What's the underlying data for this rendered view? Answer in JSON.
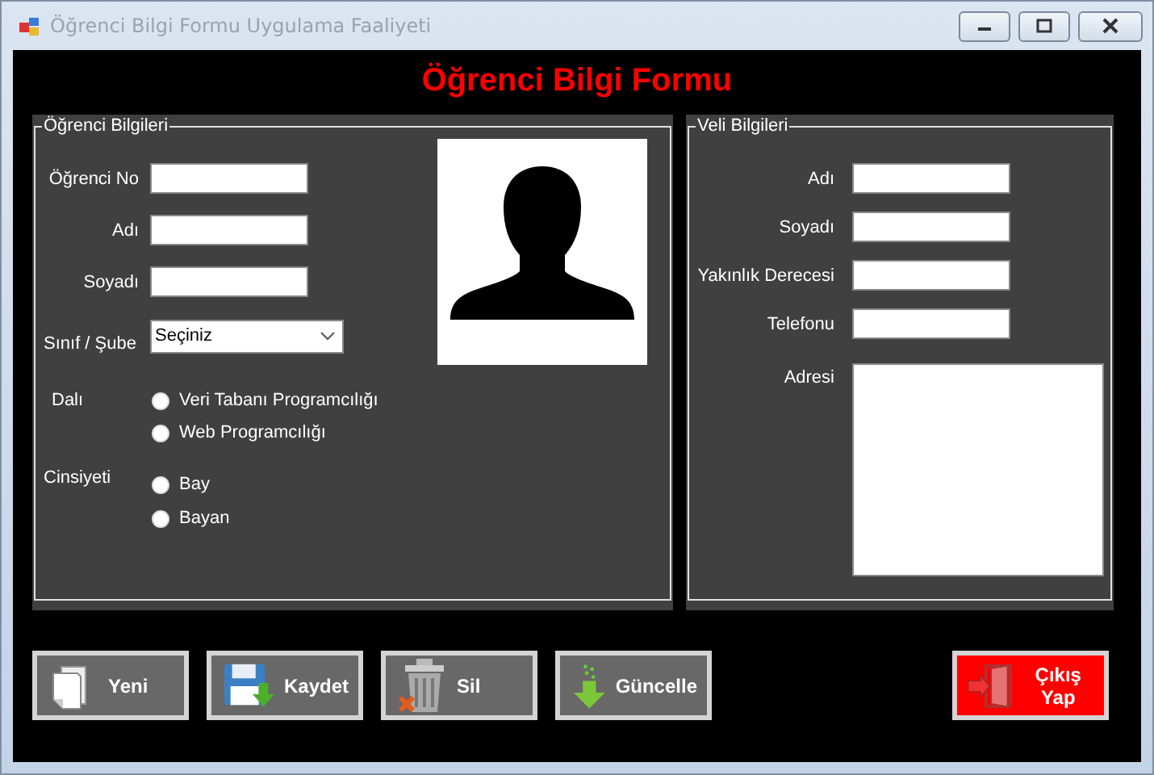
{
  "window": {
    "title": "Öğrenci Bilgi Formu Uygulama Faaliyeti"
  },
  "heading": "Öğrenci Bilgi Formu",
  "student": {
    "title": "Öğrenci Bilgileri",
    "fields": [
      {
        "label": "Öğrenci No",
        "kind": "text"
      },
      {
        "label": "Adı",
        "kind": "text"
      },
      {
        "label": "Soyadı",
        "kind": "text"
      },
      {
        "label": "Sınıf / Şube",
        "kind": "combo",
        "value": "Seçiniz"
      }
    ],
    "branch": {
      "label": "Dalı",
      "options": [
        {
          "label": "Veri Tabanı Programcılığı",
          "selected": false
        },
        {
          "label": "Web Programcılığı",
          "selected": false
        }
      ]
    },
    "gender": {
      "label": "Cinsiyeti",
      "options": [
        {
          "label": "Bay",
          "selected": false
        },
        {
          "label": "Bayan",
          "selected": false
        }
      ]
    }
  },
  "parent": {
    "title": "Veli Bilgileri",
    "fields": [
      {
        "label": "Adı",
        "kind": "text"
      },
      {
        "label": "Soyadı",
        "kind": "text"
      },
      {
        "label": "Yakınlık Derecesi",
        "kind": "text"
      },
      {
        "label": "Telefonu",
        "kind": "text"
      },
      {
        "label": "Adresi",
        "kind": "multiline"
      }
    ]
  },
  "buttons": [
    {
      "label": "Yeni",
      "kind": "new"
    },
    {
      "label": "Kaydet",
      "kind": "save"
    },
    {
      "label": "Sil",
      "kind": "delete"
    },
    {
      "label": "Güncelle",
      "kind": "update"
    },
    {
      "label": "Çıkış Yap",
      "kind": "exit"
    }
  ]
}
